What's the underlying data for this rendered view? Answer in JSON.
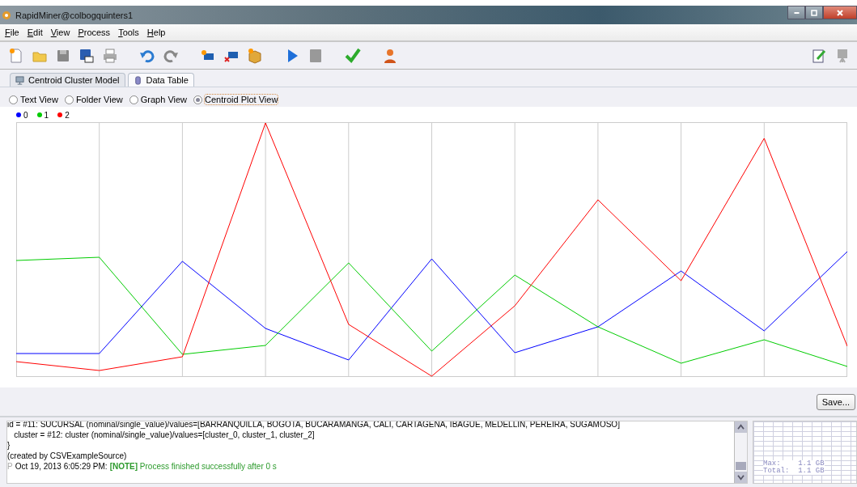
{
  "window": {
    "title": "RapidMiner@colbogquinters1"
  },
  "menu": [
    {
      "label": "File"
    },
    {
      "label": "Edit"
    },
    {
      "label": "View"
    },
    {
      "label": "Process"
    },
    {
      "label": "Tools"
    },
    {
      "label": "Help"
    }
  ],
  "tabs": [
    {
      "label": "Centroid Cluster Model",
      "selected": false
    },
    {
      "label": "Data Table",
      "selected": true
    }
  ],
  "views": [
    {
      "label": "Text View",
      "selected": false
    },
    {
      "label": "Folder View",
      "selected": false
    },
    {
      "label": "Graph View",
      "selected": false
    },
    {
      "label": "Centroid Plot View",
      "selected": true
    }
  ],
  "legend": [
    {
      "label": "0",
      "color": "#0000ff"
    },
    {
      "label": "1",
      "color": "#00cc00"
    },
    {
      "label": "2",
      "color": "#ff0000"
    }
  ],
  "save_button": "Save...",
  "log": {
    "lines": [
      "id = #11: SUCURSAL (nominal/single_value)/values=[BARRANQUILLA, BOGOTA, BUCARAMANGA, CALI, CARTAGENA, IBAGUE, MEDELLIN, PEREIRA, SUGAMOSO]",
      "   cluster = #12: cluster (nominal/single_value)/values=[cluster_0, cluster_1, cluster_2]",
      "}",
      "(created by CSVExampleSource)"
    ],
    "status": {
      "prefix": "P",
      "time": "Oct 19, 2013 6:05:29 PM:",
      "message": "**[NOTE]** Process finished successfully after 0 s"
    }
  },
  "memory": {
    "max": "Max:    1.1 GB",
    "total": "Total:  1.1 GB"
  }
}
